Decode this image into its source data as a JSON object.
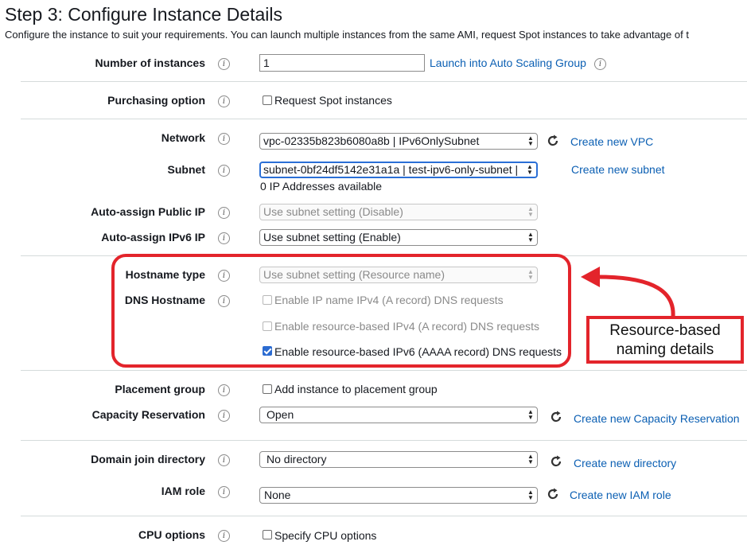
{
  "page": {
    "title": "Step 3: Configure Instance Details",
    "subtitle": "Configure the instance to suit your requirements. You can launch multiple instances from the same AMI, request Spot instances to take advantage of t"
  },
  "fields": {
    "number_of_instances": {
      "label": "Number of instances",
      "value": "1",
      "link": "Launch into Auto Scaling Group"
    },
    "purchasing_option": {
      "label": "Purchasing option",
      "checkbox": "Request Spot instances",
      "checked": false
    },
    "network": {
      "label": "Network",
      "value": "vpc-02335b823b6080a8b | IPv6OnlySubnet",
      "link": "Create new VPC"
    },
    "subnet": {
      "label": "Subnet",
      "value": "subnet-0bf24df5142e31a1a | test-ipv6-only-subnet |",
      "note": "0 IP Addresses available",
      "link": "Create new subnet"
    },
    "auto_assign_public_ip": {
      "label": "Auto-assign Public IP",
      "value": "Use subnet setting (Disable)"
    },
    "auto_assign_ipv6_ip": {
      "label": "Auto-assign IPv6 IP",
      "value": "Use subnet setting (Enable)"
    },
    "hostname_type": {
      "label": "Hostname type",
      "value": "Use subnet setting (Resource name)"
    },
    "dns_hostname": {
      "label": "DNS Hostname",
      "options": [
        {
          "label": "Enable IP name IPv4 (A record) DNS requests",
          "checked": false,
          "disabled": true
        },
        {
          "label": "Enable resource-based IPv4 (A record) DNS requests",
          "checked": false,
          "disabled": true
        },
        {
          "label": "Enable resource-based IPv6 (AAAA record) DNS requests",
          "checked": true,
          "disabled": false
        }
      ]
    },
    "placement_group": {
      "label": "Placement group",
      "checkbox": "Add instance to placement group",
      "checked": false
    },
    "capacity_reservation": {
      "label": "Capacity Reservation",
      "value": "Open",
      "link": "Create new Capacity Reservation"
    },
    "domain_join_directory": {
      "label": "Domain join directory",
      "value": "No directory",
      "link": "Create new directory"
    },
    "iam_role": {
      "label": "IAM role",
      "value": "None",
      "link": "Create new IAM role"
    },
    "cpu_options": {
      "label": "CPU options",
      "checkbox": "Specify CPU options",
      "checked": false
    }
  },
  "annotation": {
    "callout_line1": "Resource-based",
    "callout_line2": "naming details",
    "color": "#e3242b"
  },
  "colors": {
    "link": "#0b5fb3",
    "checkbox_checked": "#2b6bd1",
    "focus": "#2a6fd6"
  }
}
